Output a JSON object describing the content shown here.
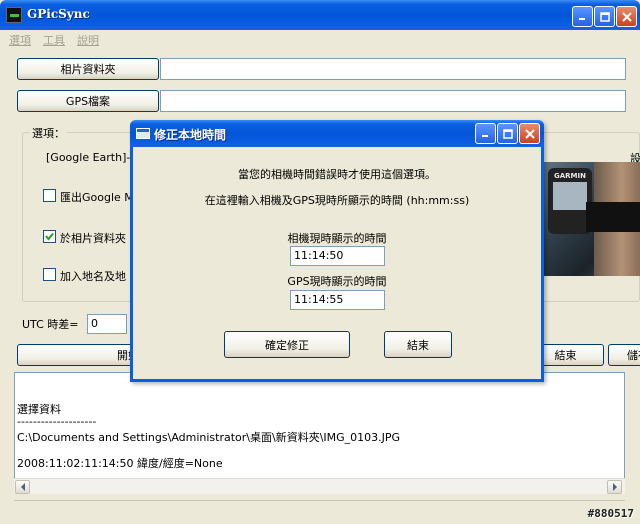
{
  "window": {
    "title": "GPicSync",
    "menu": [
      "選項",
      "工具",
      "說明"
    ]
  },
  "main": {
    "photo_folder_button": "相片資料夾",
    "photo_folder_value": "",
    "gps_file_button": "GPS檔案",
    "gps_file_value": "",
    "options_label": "選項：",
    "google_earth_label": "[Google Earth]-:",
    "export_google_label": "匯出Google M",
    "export_google_checked": false,
    "in_photo_folder_label": "於相片資料夾",
    "in_photo_folder_checked": true,
    "add_place_label": "加入地名及地",
    "add_place_checked": false,
    "cut_text": "設",
    "utc_label": "UTC 時差=",
    "utc_value": "0",
    "start_button": "開始",
    "stop_button": "結束",
    "save_button": "儲存",
    "photo_brand": "GARMIN"
  },
  "log": {
    "lines": [
      "選擇資料",
      "--------------------",
      "C:\\Documents and Settings\\Administrator\\桌面\\新資料夾\\IMG_0103.JPG",
      "2008:11:02:11:14:50    緯度/經度=None"
    ]
  },
  "watermark": "#880517",
  "dialog": {
    "title": "修正本地時間",
    "info1": "當您的相機時間錯誤時才使用這個選項。",
    "info2": "在這裡輸入相機及GPS現時所顯示的時間 (hh:mm:ss)",
    "camera_label": "相機現時顯示的時間",
    "camera_time": "11:14:50",
    "gps_label": "GPS現時顯示的時間",
    "gps_time": "11:14:55",
    "confirm_button": "確定修正",
    "close_button": "結束"
  }
}
